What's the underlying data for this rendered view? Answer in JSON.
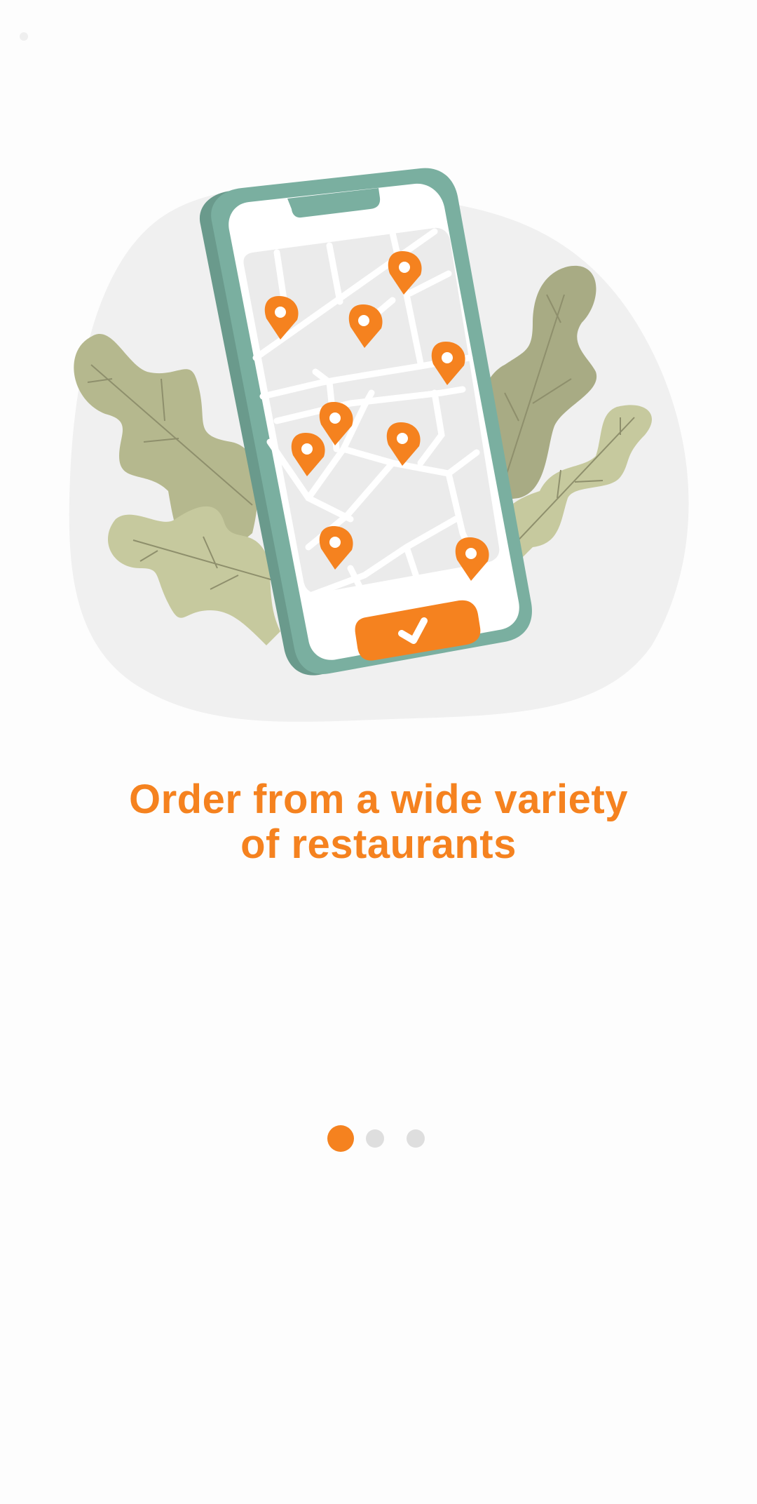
{
  "onboarding": {
    "headline_line1": "Order from a wide variety",
    "headline_line2": "of restaurants",
    "page_count": 3,
    "current_page": 1
  },
  "illustration": {
    "icons": [
      "phone-icon",
      "map-icon",
      "map-pin-icon",
      "checkmark-icon",
      "leaf-icon"
    ]
  },
  "colors": {
    "accent": "#f5821f",
    "phone_frame": "#7aafa0",
    "blob_background": "#f0f0f0",
    "leaf_dark": "#a8ab84",
    "leaf_light": "#c6c99e",
    "dot_inactive": "#dedede"
  }
}
